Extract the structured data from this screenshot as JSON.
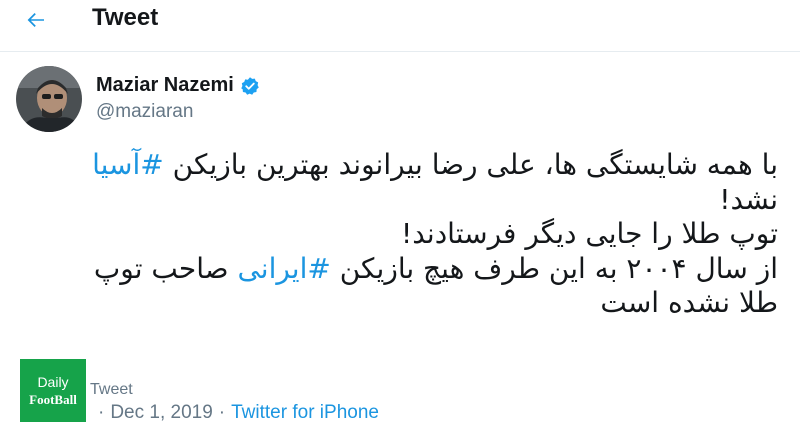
{
  "header": {
    "back_icon": "arrow-left-icon",
    "title": "Tweet",
    "accent_color": "#1b95e0"
  },
  "author": {
    "display_name": "Maziar Nazemi",
    "handle": "@maziaran",
    "verified_icon": "verified-badge-icon",
    "verified_color": "#1da1f2"
  },
  "tweet": {
    "line1_prefix": "با همه شایستگی ها، علی رضا بیرانوند بهترین بازیکن ",
    "line1_hashtag": "#آسیا",
    "line2": "نشد!",
    "line3": "توپ طلا را جایی دیگر  فرستادند!",
    "line4_prefix": "از سال ۲۰۰۴ به این طرف هیچ بازیکن ",
    "line4_hashtag": "#ایرانی",
    "line4_suffix": " صاحب توپ",
    "line5": "طلا نشده است",
    "hashtag_color": "#1b95e0"
  },
  "meta": {
    "partial_label": "Tweet",
    "date": "Dec 1, 2019",
    "separator": "·",
    "source": "Twitter for iPhone"
  },
  "watermark": {
    "line1": "Daily",
    "line2": "FootBall",
    "color": "#16a34a"
  }
}
